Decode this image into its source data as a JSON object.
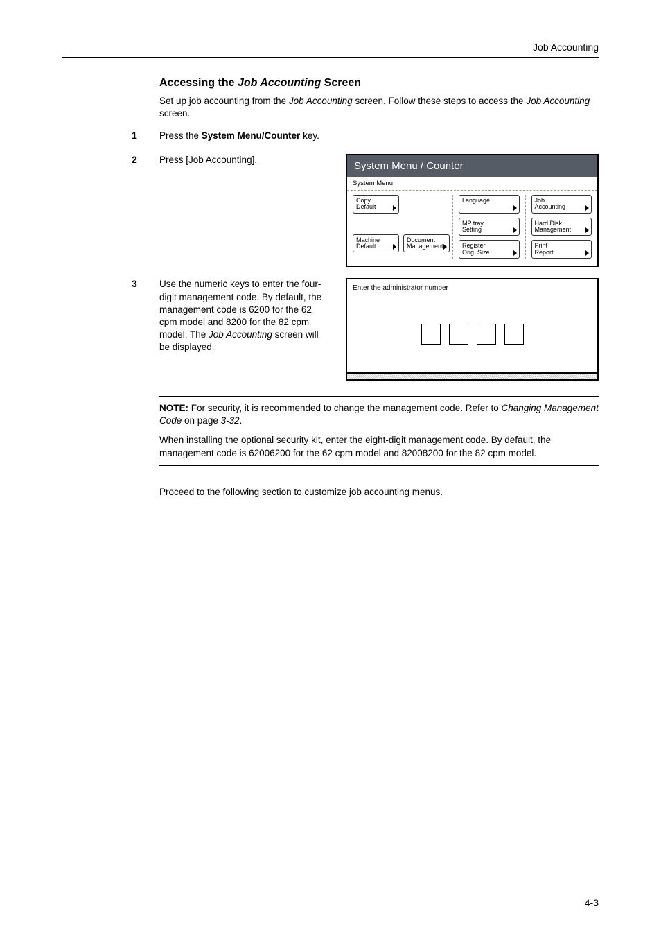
{
  "header": {
    "chapter": "Job Accounting"
  },
  "heading": {
    "pre": "Accessing the ",
    "ital": "Job Accounting",
    "post": " Screen"
  },
  "intro": {
    "pre": "Set up job accounting from the ",
    "ital1": "Job Accounting",
    "mid": " screen. Follow these steps to access the ",
    "ital2": "Job Accounting",
    "post": " screen."
  },
  "steps": {
    "s1": {
      "num": "1",
      "pre": "Press the ",
      "bold": "System Menu/Counter",
      "post": " key."
    },
    "s2": {
      "num": "2",
      "text": "Press [Job Accounting]."
    },
    "s3": {
      "num": "3",
      "pre": "Use the numeric keys to enter the four-digit management code. By default, the management code is 6200 for the 62 cpm model and 8200 for the 82 cpm model. The ",
      "ital": "Job Accounting",
      "post": " screen will be displayed."
    }
  },
  "screen1": {
    "title": "System Menu / Counter",
    "subtitle": "System Menu",
    "buttons": {
      "copy_default": "Copy\nDefault",
      "machine_default": "Machine\nDefault",
      "doc_mgmt": "Document\nManagement",
      "language": "Language",
      "mp_tray": "MP tray\nSetting",
      "reg_orig": "Register\nOrig. Size",
      "job_acct": "Job\nAccounting",
      "hard_disk": "Hard Disk\nManagement",
      "print_report": "Print\nReport"
    }
  },
  "screen2": {
    "title": "Enter the administrator number"
  },
  "note": {
    "p1": {
      "bold": "NOTE:",
      "pre": " For security, it is recommended to change the management code. Refer to ",
      "ital1": "Changing Management Code",
      "mid": " on page ",
      "ital2": "3-32",
      "post": "."
    },
    "p2": "When installing the optional security kit, enter the eight-digit management code. By default, the management code is 62006200 for the 62 cpm model and 82008200 for the 82 cpm model."
  },
  "footer": "Proceed to the following section to customize job accounting menus.",
  "page_num": "4-3"
}
